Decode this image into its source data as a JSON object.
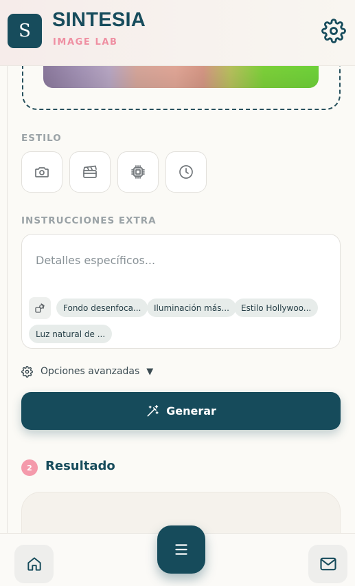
{
  "header": {
    "logo_letter": "S",
    "title": "SINTESIA",
    "subtitle": "IMAGE LAB"
  },
  "style_section": {
    "label": "ESTILO",
    "options": [
      {
        "icon": "camera-icon"
      },
      {
        "icon": "clapperboard-icon"
      },
      {
        "icon": "chip-icon"
      },
      {
        "icon": "clock-icon"
      }
    ]
  },
  "instructions": {
    "label": "INSTRUCCIONES EXTRA",
    "placeholder": "Detalles específicos...",
    "value": "",
    "chips": [
      "Fondo desenfoca...",
      "Iluminación más...",
      "Estilo Hollywoo...",
      "Luz natural de ..."
    ]
  },
  "advanced_options": {
    "label": "Opciones avanzadas",
    "arrow": "▼"
  },
  "generate_button": {
    "label": "Generar"
  },
  "result": {
    "step_number": "2",
    "title": "Resultado"
  },
  "colors": {
    "primary": "#164b5b",
    "accent_pink": "#ef8fa2",
    "background": "#fbfaf6"
  }
}
